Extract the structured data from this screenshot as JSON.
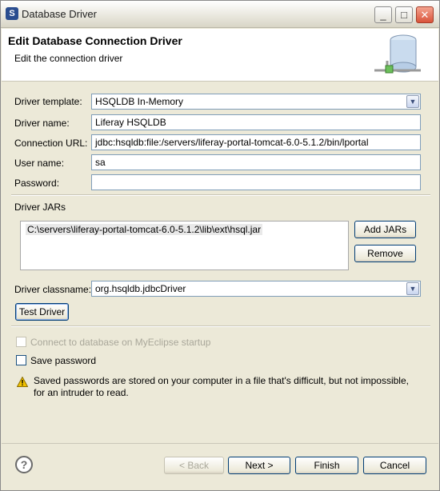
{
  "window": {
    "title": "Database Driver",
    "icon": "app-icon",
    "controls": {
      "minimize": "_",
      "maximize": "□",
      "close": "✕"
    }
  },
  "header": {
    "title": "Edit Database Connection Driver",
    "subtitle": "Edit the connection driver"
  },
  "form": {
    "driver_template_label": "Driver template:",
    "driver_template_value": "HSQLDB In-Memory",
    "driver_name_label": "Driver name:",
    "driver_name_value": "Liferay HSQLDB",
    "connection_url_label": "Connection URL:",
    "connection_url_value": "jdbc:hsqldb:file:/servers/liferay-portal-tomcat-6.0-5.1.2/bin/lportal",
    "user_name_label": "User name:",
    "user_name_value": "sa",
    "password_label": "Password:",
    "password_value": "",
    "driver_jars_label": "Driver JARs",
    "jars": [
      "C:\\servers\\liferay-portal-tomcat-6.0-5.1.2\\lib\\ext\\hsql.jar"
    ],
    "add_jars_label": "Add JARs",
    "remove_label": "Remove",
    "driver_classname_label": "Driver classname:",
    "driver_classname_value": "org.hsqldb.jdbcDriver",
    "test_driver_label": "Test Driver"
  },
  "options": {
    "connect_on_startup_label": "Connect to database on MyEclipse startup",
    "connect_on_startup_checked": false,
    "connect_on_startup_enabled": false,
    "save_password_label": "Save password",
    "save_password_checked": false,
    "warning_text": "Saved passwords are stored on your computer in a file that's difficult, but not impossible, for an intruder to read."
  },
  "footer": {
    "help": "?",
    "back_label": "< Back",
    "next_label": "Next >",
    "finish_label": "Finish",
    "cancel_label": "Cancel",
    "back_enabled": false
  },
  "colors": {
    "dialog_bg": "#ece9d8",
    "field_border": "#7f9db9",
    "button_border": "#003c74",
    "warning": "#f2c200"
  }
}
